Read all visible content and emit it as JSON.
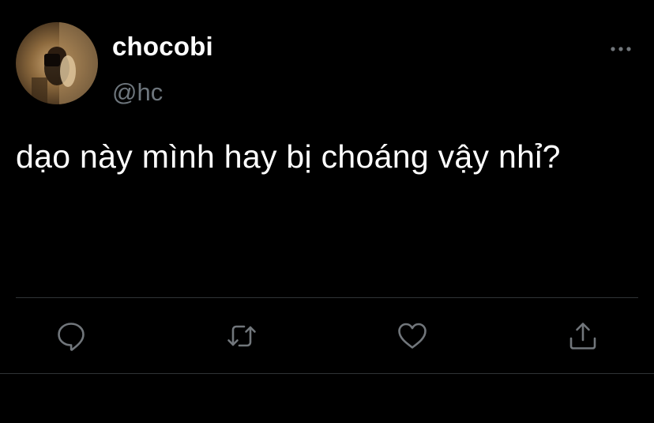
{
  "user": {
    "display_name": "chocobi",
    "handle": "@hc"
  },
  "tweet": {
    "text": "dạo này mình hay bị choáng vậy nhỉ?"
  },
  "actions": [
    {
      "icon": "reply-icon"
    },
    {
      "icon": "retweet-icon"
    },
    {
      "icon": "like-icon"
    },
    {
      "icon": "share-icon"
    }
  ],
  "colors": {
    "background": "#000000",
    "text": "#ffffff",
    "secondary": "#6e767d",
    "icon": "#71767b",
    "divider": "#2f3336"
  }
}
